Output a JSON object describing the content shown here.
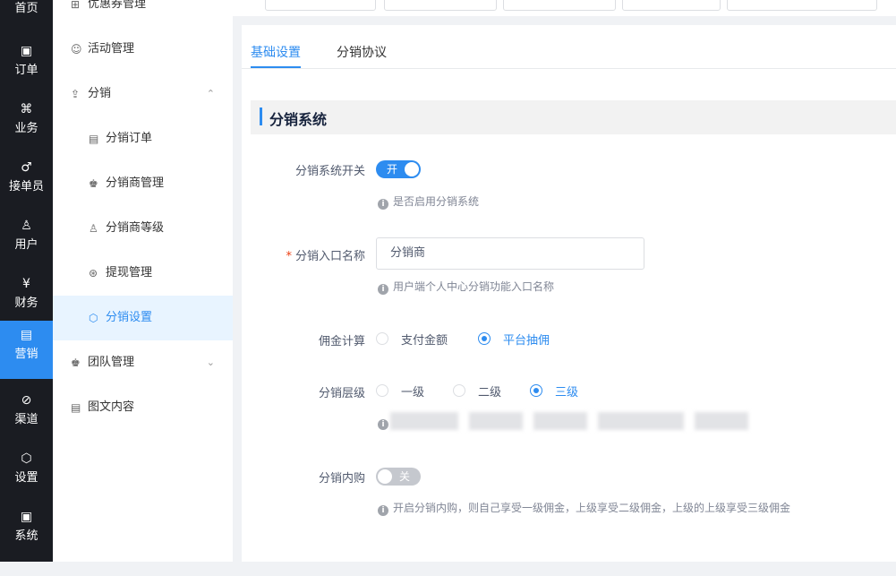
{
  "nav": {
    "items": [
      {
        "label": "首页",
        "icon": "home-icon",
        "glyph": ""
      },
      {
        "label": "订单",
        "icon": "order-icon",
        "glyph": "▣"
      },
      {
        "label": "业务",
        "icon": "business-icon",
        "glyph": "⌘"
      },
      {
        "label": "接单员",
        "icon": "courier-icon",
        "glyph": "♂"
      },
      {
        "label": "用户",
        "icon": "user-icon",
        "glyph": "♙"
      },
      {
        "label": "财务",
        "icon": "finance-icon",
        "glyph": "¥"
      },
      {
        "label": "营销",
        "icon": "marketing-icon",
        "glyph": "▤"
      },
      {
        "label": "渠道",
        "icon": "channel-icon",
        "glyph": "⊘"
      },
      {
        "label": "设置",
        "icon": "settings-icon",
        "glyph": "⬡"
      },
      {
        "label": "系统",
        "icon": "system-icon",
        "glyph": "▣"
      }
    ],
    "active_index": 6
  },
  "submenu": {
    "items": [
      {
        "label": "优惠券管理",
        "icon": "coupon-icon",
        "glyph": "⊞"
      },
      {
        "label": "活动管理",
        "icon": "activity-icon",
        "glyph": "☺"
      },
      {
        "label": "分销",
        "icon": "distribution-icon",
        "glyph": "⇪",
        "arrow": "⌃"
      },
      {
        "label": "分销订单",
        "icon": "distribution-order-icon",
        "glyph": "▤"
      },
      {
        "label": "分销商管理",
        "icon": "distributor-manage-icon",
        "glyph": "♚"
      },
      {
        "label": "分销商等级",
        "icon": "distributor-level-icon",
        "glyph": "♙"
      },
      {
        "label": "提现管理",
        "icon": "withdraw-icon",
        "glyph": "⊛"
      },
      {
        "label": "分销设置",
        "icon": "distribution-settings-icon",
        "glyph": "⬡"
      },
      {
        "label": "团队管理",
        "icon": "team-icon",
        "glyph": "♚",
        "arrow": "⌄"
      },
      {
        "label": "图文内容",
        "icon": "article-icon",
        "glyph": "▤"
      }
    ],
    "active_index": 7
  },
  "tabs": {
    "items": [
      "基础设置",
      "分销协议"
    ],
    "active_index": 0
  },
  "section_title": "分销系统",
  "form": {
    "switch_label": "分销系统开关",
    "switch_text": "开",
    "switch_on": true,
    "switch_hint": "是否启用分销系统",
    "entry_label": "分销入口名称",
    "entry_required_mark": "*",
    "entry_value": "分销商",
    "entry_hint": "用户端个人中心分销功能入口名称",
    "commission_label": "佣金计算",
    "commission_options": [
      "支付金额",
      "平台抽佣"
    ],
    "commission_selected": 1,
    "level_label": "分销层级",
    "level_options": [
      "一级",
      "二级",
      "三级"
    ],
    "level_selected": 2,
    "inner_label": "分销内购",
    "inner_switch_text": "关",
    "inner_on": false,
    "inner_hint": "开启分销内购，则自己享受一级佣金，上级享受二级佣金，上级的上级享受三级佣金",
    "hint_icon": "info-icon",
    "hint_glyph": "i"
  },
  "colors": {
    "accent": "#2d8cf0",
    "nav_bg": "#1a1c22",
    "active_submenu_bg": "#e8f4ff"
  }
}
